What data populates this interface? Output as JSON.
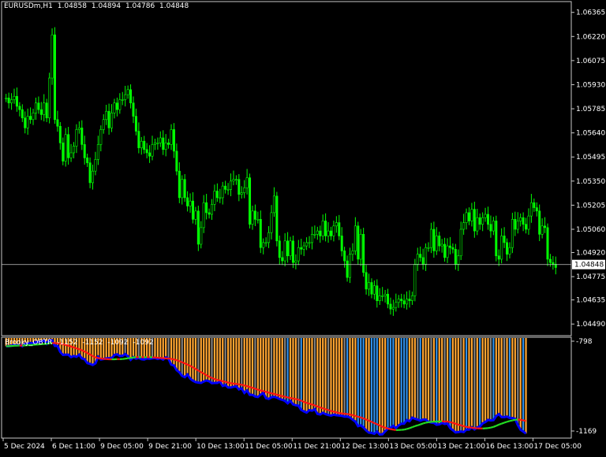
{
  "window": {
    "symbol": "EURUSDm,H1",
    "ohlc": [
      "1.04858",
      "1.04894",
      "1.04786",
      "1.04848"
    ],
    "current_price": "1.04848"
  },
  "price_axis": {
    "labels": [
      "1.06365",
      "1.06220",
      "1.06075",
      "1.05930",
      "1.05785",
      "1.05640",
      "1.05495",
      "1.05350",
      "1.05205",
      "1.05060",
      "1.04920",
      "1.04775",
      "1.04635",
      "1.04490"
    ]
  },
  "indicator": {
    "name": "Brooky_OBTR",
    "values": [
      "-1152",
      "-1152",
      "-1092",
      "-1092"
    ],
    "axis_labels": [
      "-798",
      "-1169"
    ]
  },
  "time_axis": {
    "labels": [
      "5 Dec 2024",
      "6 Dec 11:00",
      "9 Dec 05:00",
      "9 Dec 21:00",
      "10 Dec 13:00",
      "11 Dec 05:00",
      "11 Dec 21:00",
      "12 Dec 13:00",
      "13 Dec 05:00",
      "13 Dec 21:00",
      "16 Dec 13:00",
      "17 Dec 05:00"
    ]
  },
  "colors": {
    "background": "#000000",
    "grid_border": "#c8c8c8",
    "candle": "#00ff00",
    "bar_orange": "#ffa531",
    "bar_blue": "#2f8fe8",
    "bar_gray": "#808080",
    "line_red": "#ff1010",
    "line_green": "#22dd22",
    "area_blue": "#0000ff",
    "price_label_bg": "#ffffff",
    "price_label_fg": "#000000"
  },
  "chart_data": [
    {
      "type": "candlestick",
      "ylim": [
        1.0442,
        1.0643
      ],
      "close": [
        1.0585,
        1.0582,
        1.0584,
        1.0586,
        1.058,
        1.0578,
        1.0573,
        1.0567,
        1.0574,
        1.0572,
        1.0576,
        1.0582,
        1.0578,
        1.0575,
        1.0582,
        1.0573,
        1.0597,
        1.0623,
        1.0572,
        1.0568,
        1.0558,
        1.0547,
        1.0563,
        1.0549,
        1.0552,
        1.0556,
        1.0566,
        1.0567,
        1.0557,
        1.0549,
        1.0546,
        1.0534,
        1.0541,
        1.0548,
        1.0557,
        1.0566,
        1.0572,
        1.0577,
        1.0567,
        1.0576,
        1.0582,
        1.0578,
        1.0584,
        1.0584,
        1.0587,
        1.059,
        1.0582,
        1.0574,
        1.0565,
        1.0555,
        1.0559,
        1.0554,
        1.0552,
        1.055,
        1.0557,
        1.0558,
        1.0558,
        1.0561,
        1.0554,
        1.0558,
        1.0557,
        1.0566,
        1.0553,
        1.0541,
        1.0525,
        1.0536,
        1.0525,
        1.052,
        1.0523,
        1.0512,
        1.0517,
        1.0497,
        1.0507,
        1.0522,
        1.0516,
        1.0515,
        1.0521,
        1.0529,
        1.0525,
        1.0525,
        1.0532,
        1.053,
        1.053,
        1.0535,
        1.0536,
        1.0536,
        1.0527,
        1.0528,
        1.0531,
        1.0537,
        1.0509,
        1.0517,
        1.0512,
        1.0512,
        1.0495,
        1.0498,
        1.0498,
        1.0504,
        1.0516,
        1.0526,
        1.0499,
        1.0489,
        1.0487,
        1.0499,
        1.049,
        1.0499,
        1.0486,
        1.0487,
        1.0495,
        1.0494,
        1.0496,
        1.0498,
        1.0498,
        1.0503,
        1.0503,
        1.0505,
        1.0502,
        1.0511,
        1.0502,
        1.0505,
        1.0502,
        1.0508,
        1.051,
        1.0502,
        1.0493,
        1.0487,
        1.0477,
        1.0491,
        1.0493,
        1.0508,
        1.0488,
        1.0503,
        1.048,
        1.047,
        1.0474,
        1.0467,
        1.0472,
        1.0463,
        1.0466,
        1.0466,
        1.0467,
        1.0461,
        1.0458,
        1.0459,
        1.0462,
        1.0464,
        1.0463,
        1.0461,
        1.0464,
        1.0463,
        1.0466,
        1.0485,
        1.0491,
        1.0489,
        1.0485,
        1.0495,
        1.0495,
        1.0506,
        1.0493,
        1.0502,
        1.0496,
        1.0497,
        1.0489,
        1.0496,
        1.0495,
        1.0494,
        1.0485,
        1.049,
        1.0506,
        1.051,
        1.0516,
        1.0511,
        1.0518,
        1.0505,
        1.0513,
        1.0509,
        1.0513,
        1.0515,
        1.0509,
        1.0505,
        1.0511,
        1.049,
        1.0488,
        1.0502,
        1.0498,
        1.0491,
        1.0495,
        1.0512,
        1.0506,
        1.0511,
        1.0513,
        1.0509,
        1.0506,
        1.0514,
        1.0522,
        1.0519,
        1.0517,
        1.0503,
        1.0508,
        1.0507,
        1.0488,
        1.0486,
        1.0485,
        1.0483
      ],
      "start_label": "5 Dec 2024"
    },
    {
      "type": "bar",
      "series": [
        {
          "name": "Brooky_OBTR",
          "values": [
            -831,
            -831,
            -829,
            -826,
            -828,
            -826,
            -831,
            -822,
            -822,
            -819,
            -821,
            -816,
            -815,
            -814,
            -810,
            -822,
            -808,
            -809,
            -830,
            -830,
            -852,
            -863,
            -862,
            -862,
            -871,
            -867,
            -870,
            -862,
            -876,
            -879,
            -893,
            -896,
            -900,
            -894,
            -870,
            -880,
            -878,
            -876,
            -875,
            -875,
            -863,
            -861,
            -867,
            -866,
            -860,
            -868,
            -881,
            -871,
            -877,
            -874,
            -879,
            -880,
            -876,
            -877,
            -875,
            -874,
            -878,
            -875,
            -880,
            -872,
            -877,
            -899,
            -902,
            -919,
            -927,
            -940,
            -945,
            -935,
            -950,
            -958,
            -963,
            -965,
            -966,
            -961,
            -957,
            -960,
            -967,
            -966,
            -966,
            -961,
            -977,
            -974,
            -983,
            -983,
            -980,
            -978,
            -990,
            -986,
            -1003,
            -994,
            -1010,
            -1010,
            -1016,
            -1018,
            -1009,
            -1003,
            -1022,
            -1025,
            -1019,
            -1017,
            -1020,
            -1025,
            -1028,
            -1032,
            -1041,
            -1032,
            -1045,
            -1048,
            -1050,
            -1065,
            -1071,
            -1075,
            -1066,
            -1068,
            -1063,
            -1080,
            -1082,
            -1076,
            -1081,
            -1084,
            -1086,
            -1083,
            -1085,
            -1086,
            -1087,
            -1090,
            -1090,
            -1093,
            -1101,
            -1108,
            -1125,
            -1122,
            -1130,
            -1141,
            -1149,
            -1150,
            -1153,
            -1145,
            -1156,
            -1155,
            -1144,
            -1134,
            -1131,
            -1124,
            -1132,
            -1122,
            -1116,
            -1116,
            -1103,
            -1107,
            -1094,
            -1098,
            -1101,
            -1105,
            -1101,
            -1101,
            -1109,
            -1112,
            -1113,
            -1120,
            -1119,
            -1113,
            -1117,
            -1115,
            -1132,
            -1140,
            -1148,
            -1147,
            -1145,
            -1147,
            -1138,
            -1138,
            -1129,
            -1137,
            -1130,
            -1126,
            -1115,
            -1110,
            -1102,
            -1104,
            -1103,
            -1088,
            -1081,
            -1092,
            -1092,
            -1090,
            -1095,
            -1095,
            -1098,
            -1121,
            -1138,
            -1145,
            -1152
          ]
        }
      ],
      "ylim": [
        -1169,
        -798
      ]
    }
  ]
}
